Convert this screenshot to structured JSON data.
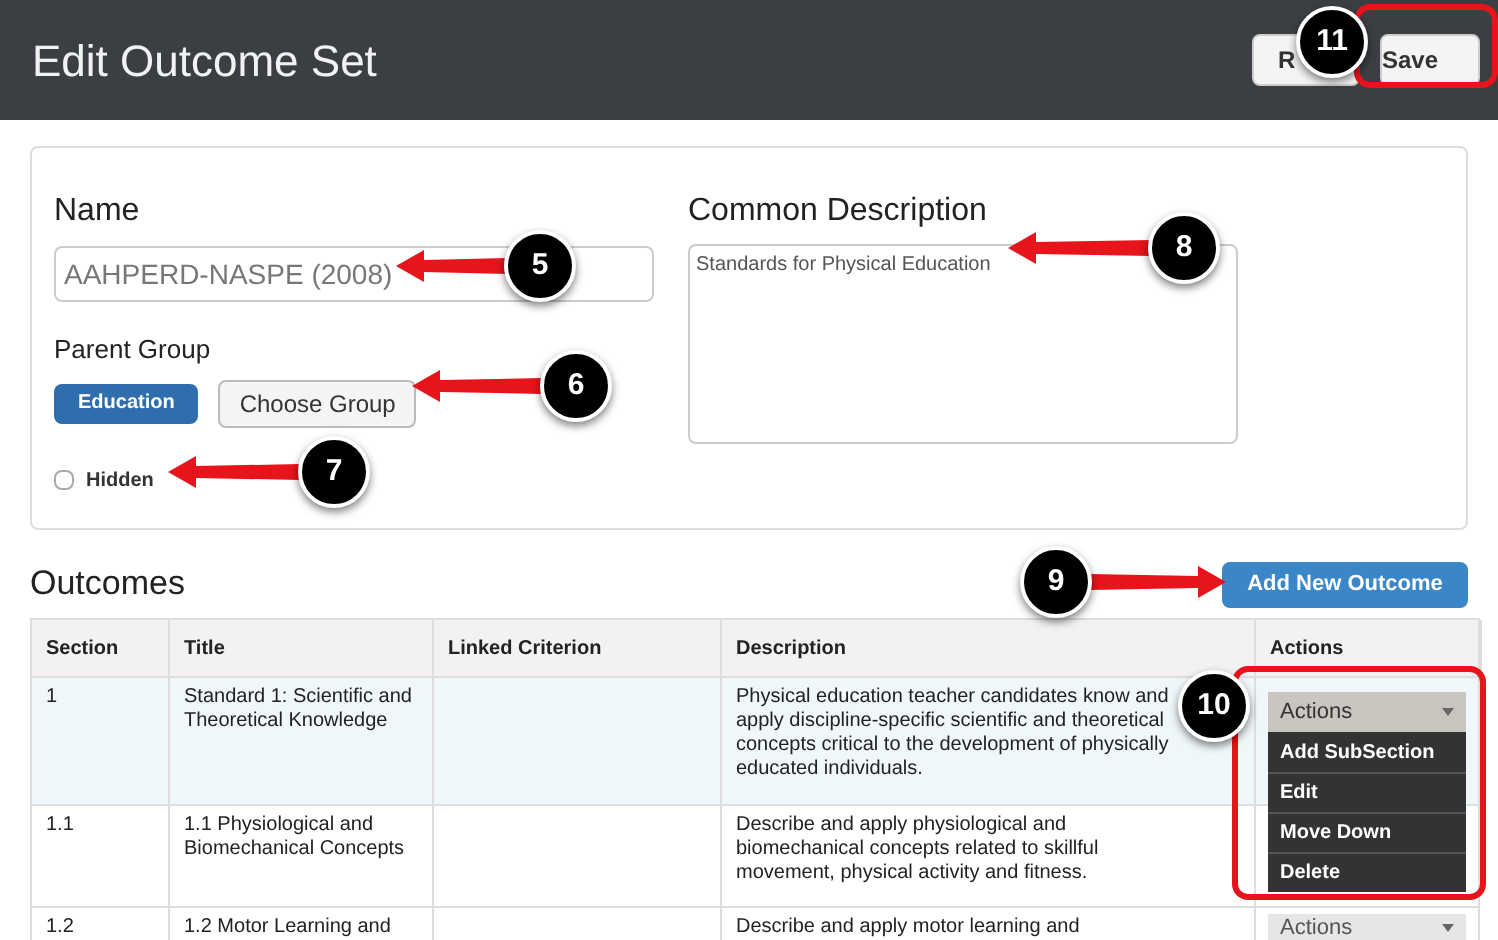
{
  "header": {
    "title": "Edit Outcome Set",
    "buttons": [
      {
        "label": "R"
      },
      {
        "label": "Save"
      }
    ]
  },
  "form": {
    "name_label": "Name",
    "name_value": "AAHPERD-NASPE (2008)",
    "parent_group_label": "Parent Group",
    "parent_group_tag": "Education",
    "choose_group_button": "Choose Group",
    "hidden_label": "Hidden",
    "hidden_checked": false,
    "description_label": "Common Description",
    "description_value": "Standards for Physical Education"
  },
  "outcomes": {
    "heading": "Outcomes",
    "add_button": "Add New Outcome",
    "columns": [
      "Section",
      "Title",
      "Linked Criterion",
      "Description",
      "Actions"
    ],
    "rows": [
      {
        "section": "1",
        "title": "Standard 1: Scientific and Theoretical Knowledge",
        "description": "Physical education teacher candidates know and apply discipline-specific scientific and theoretical concepts critical to the development of physically educated individuals.",
        "highlighted": true,
        "actions": {
          "label": "Actions",
          "expanded": true,
          "items": [
            "Add SubSection",
            "Edit",
            "Move Down",
            "Delete"
          ]
        }
      },
      {
        "section": "1.1",
        "title": "1.1 Physiological and Biomechanical Concepts",
        "description": "Describe and apply physiological and biomechanical concepts related to skillful movement, physical activity and fitness.",
        "highlighted": false
      },
      {
        "section": "1.2",
        "title": "1.2 Motor Learning and",
        "description": "Describe and apply motor learning and",
        "highlighted": false,
        "actions": {
          "label": "Actions",
          "expanded": false
        }
      }
    ]
  },
  "callouts": [
    {
      "number": "5"
    },
    {
      "number": "6"
    },
    {
      "number": "7"
    },
    {
      "number": "8"
    },
    {
      "number": "9"
    },
    {
      "number": "10"
    },
    {
      "number": "11"
    }
  ]
}
